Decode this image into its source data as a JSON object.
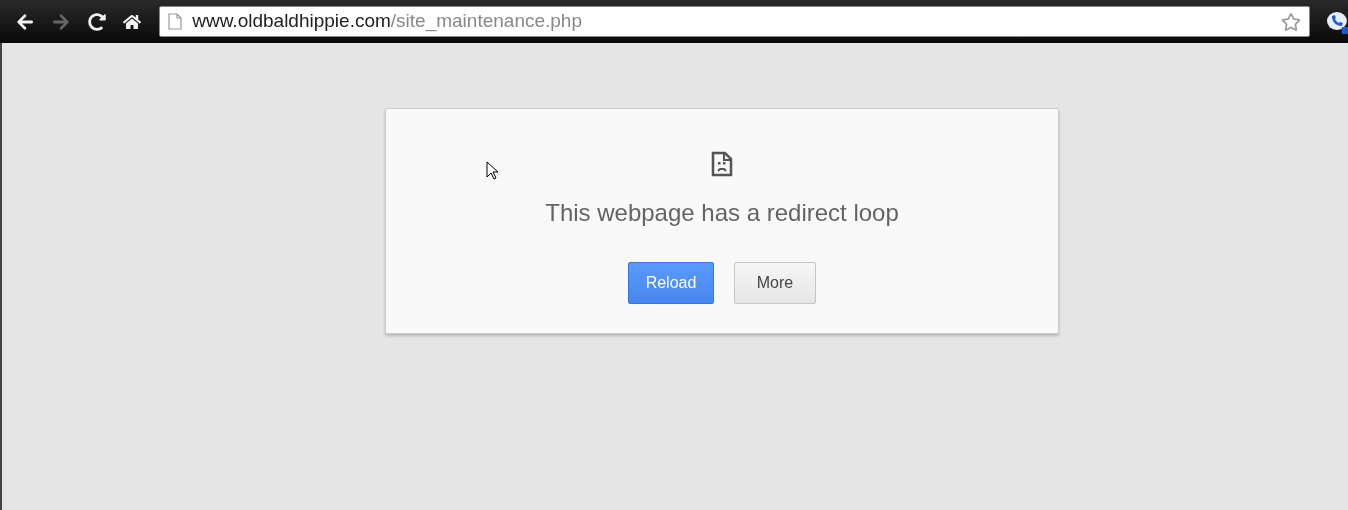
{
  "toolbar": {
    "buttons": [
      {
        "kind": "back",
        "disabled": false
      },
      {
        "kind": "forward",
        "disabled": true
      },
      {
        "kind": "reload",
        "disabled": false
      },
      {
        "kind": "home",
        "disabled": false
      }
    ],
    "address_bar": {
      "host": "www.oldbaldhippie.com",
      "path": "/site_maintenance.php",
      "bookmarked": false
    }
  },
  "error_card": {
    "title": "This webpage has a redirect loop",
    "buttons": [
      {
        "label": "Reload",
        "kind": "primary"
      },
      {
        "label": "More",
        "kind": "secondary"
      }
    ]
  }
}
